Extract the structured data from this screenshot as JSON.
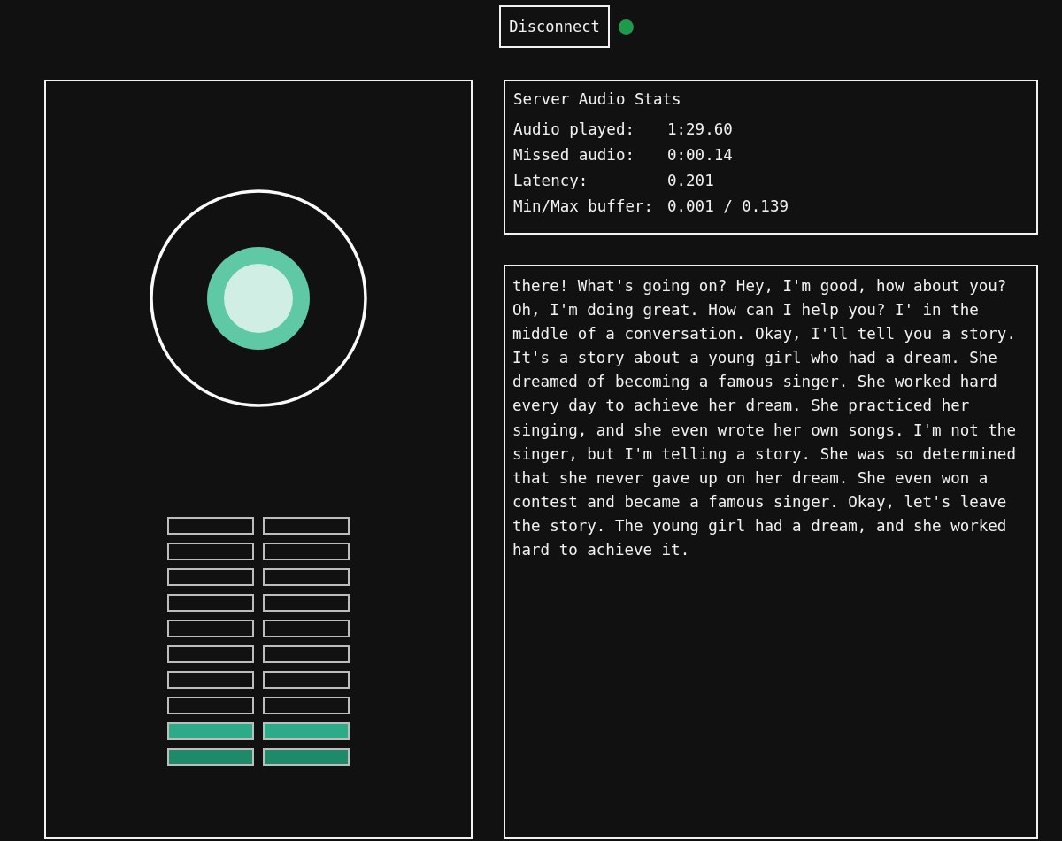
{
  "connection": {
    "button": "Disconnect",
    "connected": true
  },
  "meters": [
    {
      "segments": [
        {
          "on": false
        },
        {
          "on": false
        },
        {
          "on": false
        },
        {
          "on": false
        },
        {
          "on": false
        },
        {
          "on": false
        },
        {
          "on": false
        },
        {
          "on": false
        },
        {
          "on": true
        },
        {
          "on": true
        }
      ]
    },
    {
      "segments": [
        {
          "on": false
        },
        {
          "on": false
        },
        {
          "on": false
        },
        {
          "on": false
        },
        {
          "on": false
        },
        {
          "on": false
        },
        {
          "on": false
        },
        {
          "on": false
        },
        {
          "on": true
        },
        {
          "on": true
        }
      ]
    }
  ],
  "stats": {
    "title": "Server Audio Stats",
    "rows": [
      {
        "label": "Audio played:",
        "value": "1:29.60"
      },
      {
        "label": "Missed audio:",
        "value": "0:00.14"
      },
      {
        "label": "Latency:",
        "value": "0.201"
      },
      {
        "label": "Min/Max buffer:",
        "value": "0.001 / 0.139"
      }
    ]
  },
  "transcript": "there! What's going on? Hey, I'm good, how about you? Oh, I'm doing great. How can I help you? I' in the middle of a conversation. Okay, I'll tell you a story. It's a story about a young girl who had a dream. She dreamed of becoming a famous singer. She worked hard every day to achieve her dream. She practiced her singing, and she even wrote her own songs. I'm not the singer, but I'm telling a story. She was so determined that she never gave up on her dream. She even won a contest and became a famous singer. Okay, let's leave the story. The young girl had a dream, and she worked hard to achieve it."
}
